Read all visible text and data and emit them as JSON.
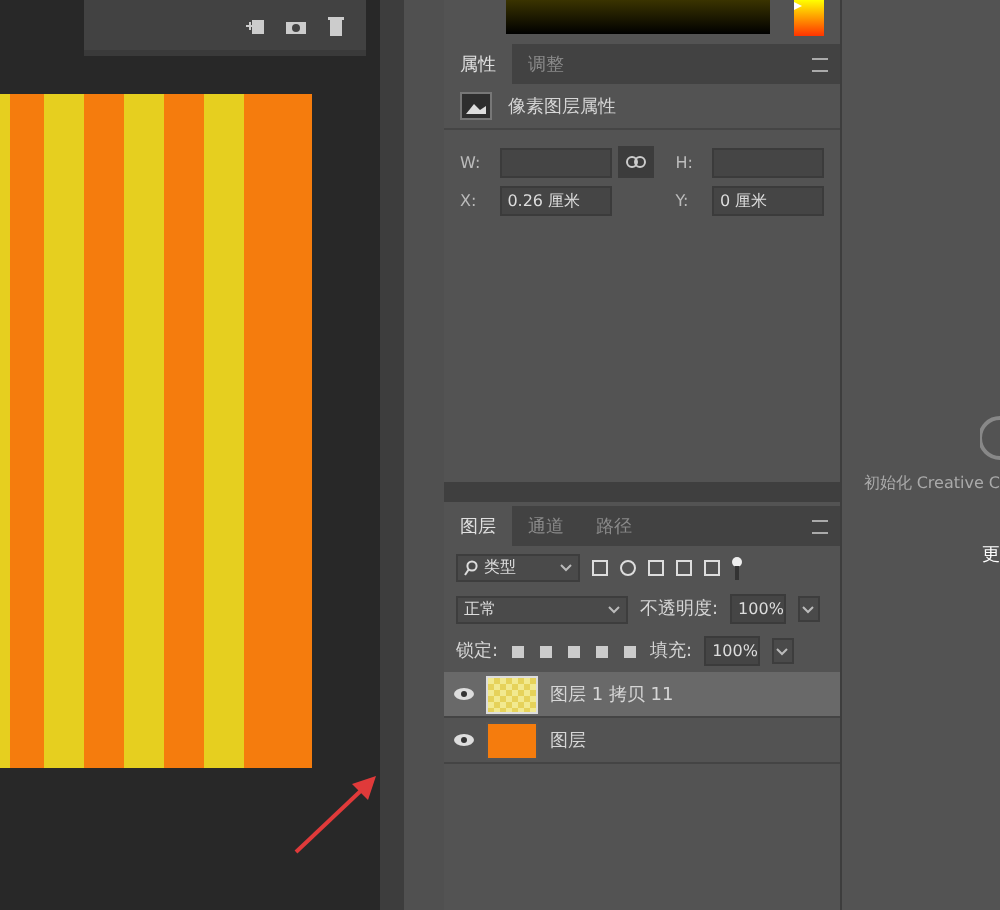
{
  "color_picker": {
    "hue_slider": {
      "level": 0.95
    }
  },
  "properties": {
    "tabs": [
      {
        "label": "属性",
        "selected": true
      },
      {
        "label": "调整",
        "selected": false
      }
    ],
    "title": "像素图层属性",
    "fields": [
      {
        "label": "W:"
      },
      {
        "label": "H:"
      },
      {
        "label": "X:",
        "value": "0.26 厘米"
      },
      {
        "label": "Y:",
        "value": "0 厘米"
      }
    ]
  },
  "side_text": {
    "message": "初始化 Creative C",
    "cut_label": "更"
  },
  "layers_panel": {
    "tabs": [
      {
        "label": "图层",
        "selected": true
      },
      {
        "label": "通道",
        "selected": false
      },
      {
        "label": "路径",
        "selected": false
      }
    ],
    "filter": "类型",
    "blend_mode": "正常",
    "opacity_label": "不透明度:",
    "opacity": "100%",
    "lock_label": "锁定:",
    "fill_label": "填充:",
    "fill": "100%",
    "layers": [
      {
        "name": "图层 1 拷贝 11",
        "selected": true,
        "visible": true,
        "kind": "pattern"
      },
      {
        "name": "图层",
        "selected": false,
        "visible": true,
        "kind": "solid"
      }
    ]
  }
}
